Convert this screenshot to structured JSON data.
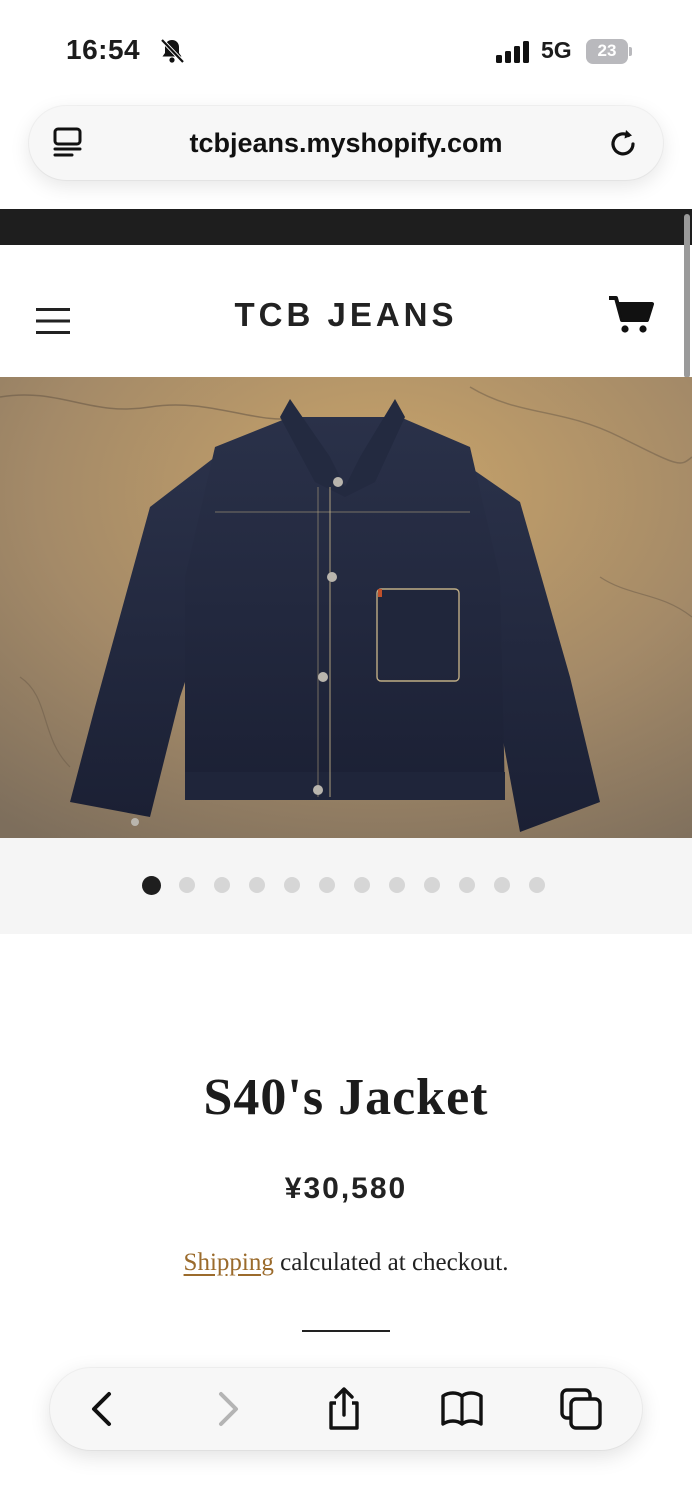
{
  "status_bar": {
    "time": "16:54",
    "network": "5G",
    "battery": "23",
    "icons": [
      "bell-slash-icon",
      "signal-bars-icon",
      "battery-icon"
    ]
  },
  "browser": {
    "url": "tcbjeans.myshopify.com",
    "icons": [
      "reader-mode-icon",
      "reload-icon"
    ]
  },
  "store": {
    "brand": "TCB JEANS",
    "icons": [
      "hamburger-menu-icon",
      "cart-icon"
    ]
  },
  "product": {
    "image_subject": "denim jacket on concrete floor",
    "carousel": {
      "total": 12,
      "active_index": 0
    },
    "title": "S40's Jacket",
    "price": "¥30,580",
    "shipping_link": "Shipping",
    "shipping_text": " calculated at checkout."
  },
  "toolbar": {
    "icons": [
      "back-icon",
      "forward-icon",
      "share-icon",
      "bookmarks-icon",
      "tabs-icon"
    ]
  },
  "colors": {
    "announcement_bar": "#1e1e1e",
    "link": "#9b6b2c",
    "dot_active": "#1e1e1e",
    "dot_inactive": "#d6d6d6"
  }
}
